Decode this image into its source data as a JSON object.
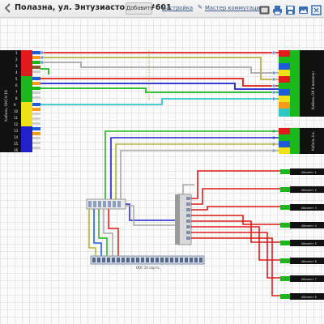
{
  "header": {
    "title": "Полазна, ул. Энтузиастов, 1а #601",
    "add_label": "Добавить",
    "settings_label": "Настройка",
    "wizard_label": "Мастер коммутации",
    "icons": [
      "back-arrow-icon",
      "number-badge-icon",
      "print-icon",
      "save-icon",
      "image-icon",
      "fullscreen-icon"
    ]
  },
  "scheme": {
    "left_box_label": "Кабель ОКСН 16",
    "bottom_box_label": "ODF 24 порта",
    "colors": {
      "red": "#e01b1b",
      "green": "#1bb81b",
      "yellow": "#f0e01b",
      "blue": "#2222c8",
      "orange": "#f59a1b",
      "gray": "#a8a8a8",
      "olive": "#b9b13a",
      "cyan": "#31c7c7",
      "dark": "#1a1a1a",
      "lightgray": "#cfcfcf"
    }
  }
}
